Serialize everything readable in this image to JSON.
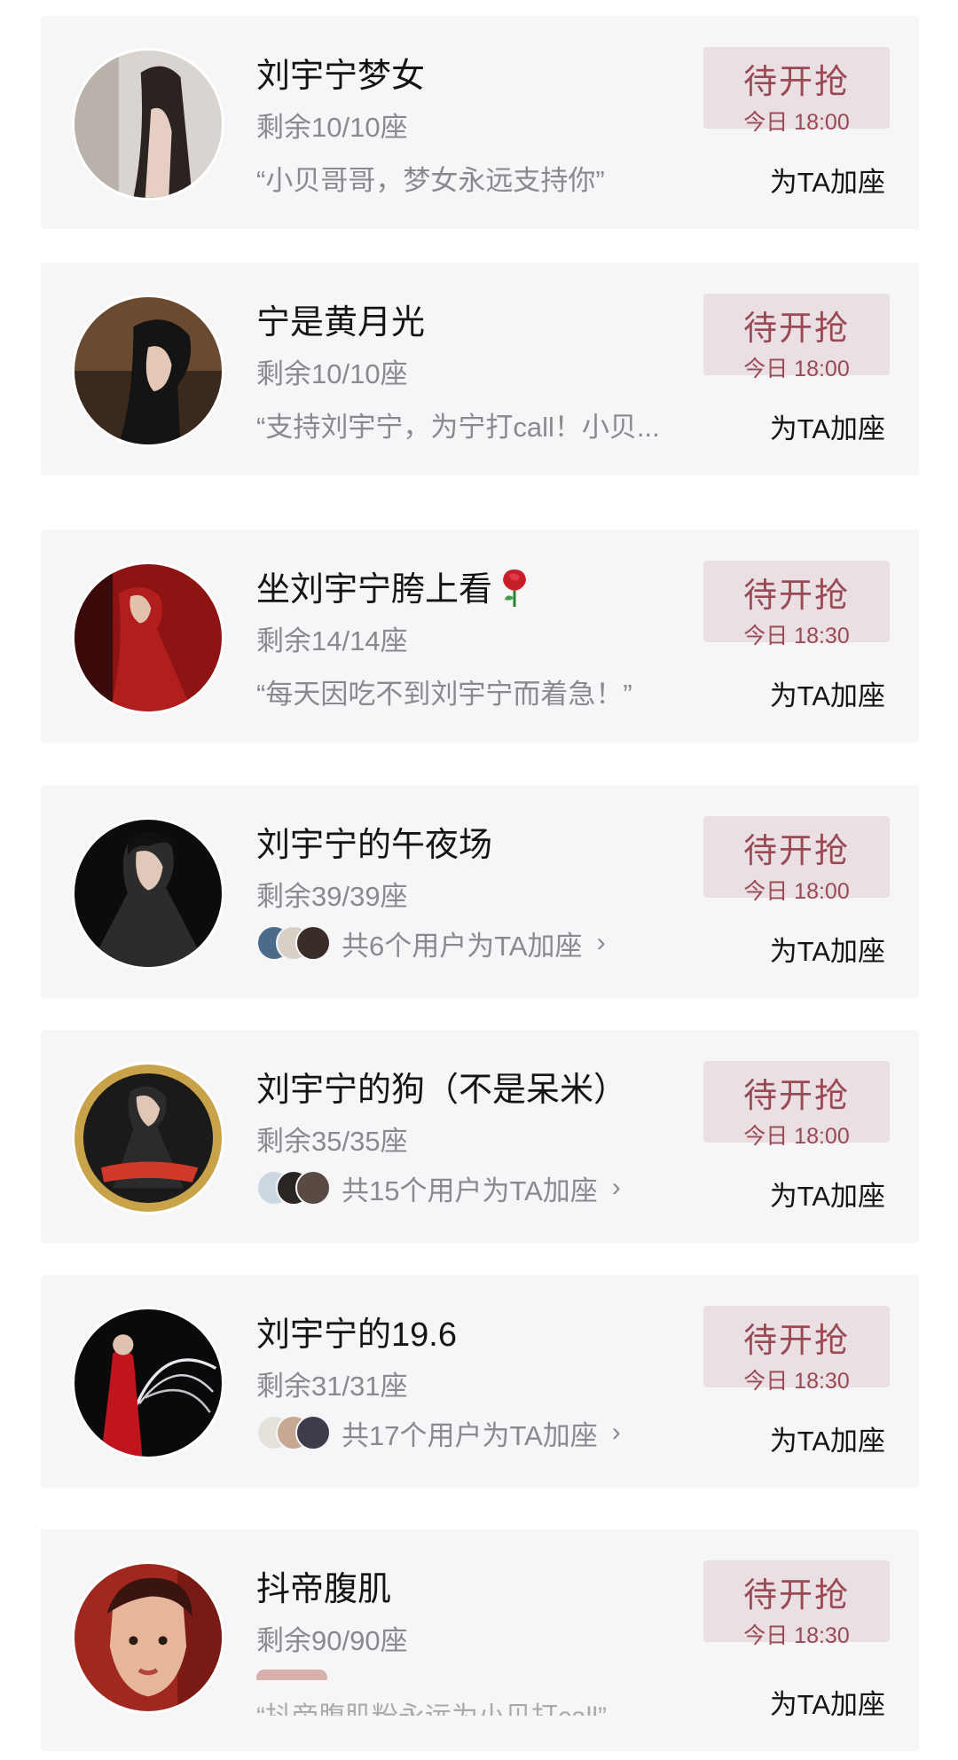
{
  "rooms": [
    {
      "title": "刘宇宁梦女",
      "remaining": "剩余10/10座",
      "quote": "“小贝哥哥，梦女永远支持你”",
      "status": "待开抢",
      "time": "今日 18:00",
      "add_seat": "为TA加座",
      "avatar_colors": [
        "#d9d4cf",
        "#2a2320"
      ]
    },
    {
      "title": "宁是黄月光",
      "remaining": "剩余10/10座",
      "quote": "“支持刘宇宁，为宁打call！小贝...",
      "status": "待开抢",
      "time": "今日 18:00",
      "add_seat": "为TA加座",
      "avatar_colors": [
        "#6b4a32",
        "#141414"
      ]
    },
    {
      "title": "坐刘宇宁胯上看",
      "title_emoji": "rose-icon",
      "remaining": "剩余14/14座",
      "quote": "“每天因吃不到刘宇宁而着急！”",
      "status": "待开抢",
      "time": "今日 18:30",
      "add_seat": "为TA加座",
      "avatar_colors": [
        "#8e1414",
        "#3a0a0a"
      ]
    },
    {
      "title": "刘宇宁的午夜场",
      "remaining": "剩余39/39座",
      "users_text": "共6个用户为TA加座",
      "status": "待开抢",
      "time": "今日 18:00",
      "add_seat": "为TA加座",
      "avatar_colors": [
        "#2c2c2c",
        "#0c0c0c"
      ]
    },
    {
      "title": "刘宇宁的狗（不是呆米）",
      "remaining": "剩余35/35座",
      "users_text": "共15个用户为TA加座",
      "status": "待开抢",
      "time": "今日 18:00",
      "add_seat": "为TA加座",
      "avatar_colors": [
        "#1a1a1a",
        "#c9a34a"
      ]
    },
    {
      "title": "刘宇宁的19.6",
      "remaining": "剩余31/31座",
      "users_text": "共17个用户为TA加座",
      "status": "待开抢",
      "time": "今日 18:30",
      "add_seat": "为TA加座",
      "avatar_colors": [
        "#0a0a0a",
        "#c0141e"
      ]
    },
    {
      "title": "抖帝腹肌",
      "remaining": "剩余90/90座",
      "quote": "“抖帝腹肌粉永远为小贝打call”",
      "status": "待开抢",
      "time": "今日 18:30",
      "add_seat": "为TA加座",
      "avatar_colors": [
        "#a1281e",
        "#e6b59a"
      ]
    }
  ],
  "chevron_icon": "chevron-right-icon",
  "colors": {
    "card_bg": "#f6f6f8",
    "status_bg": "#eadfe2",
    "status_text": "#9a4a55",
    "secondary_text": "#8a8a8e"
  }
}
